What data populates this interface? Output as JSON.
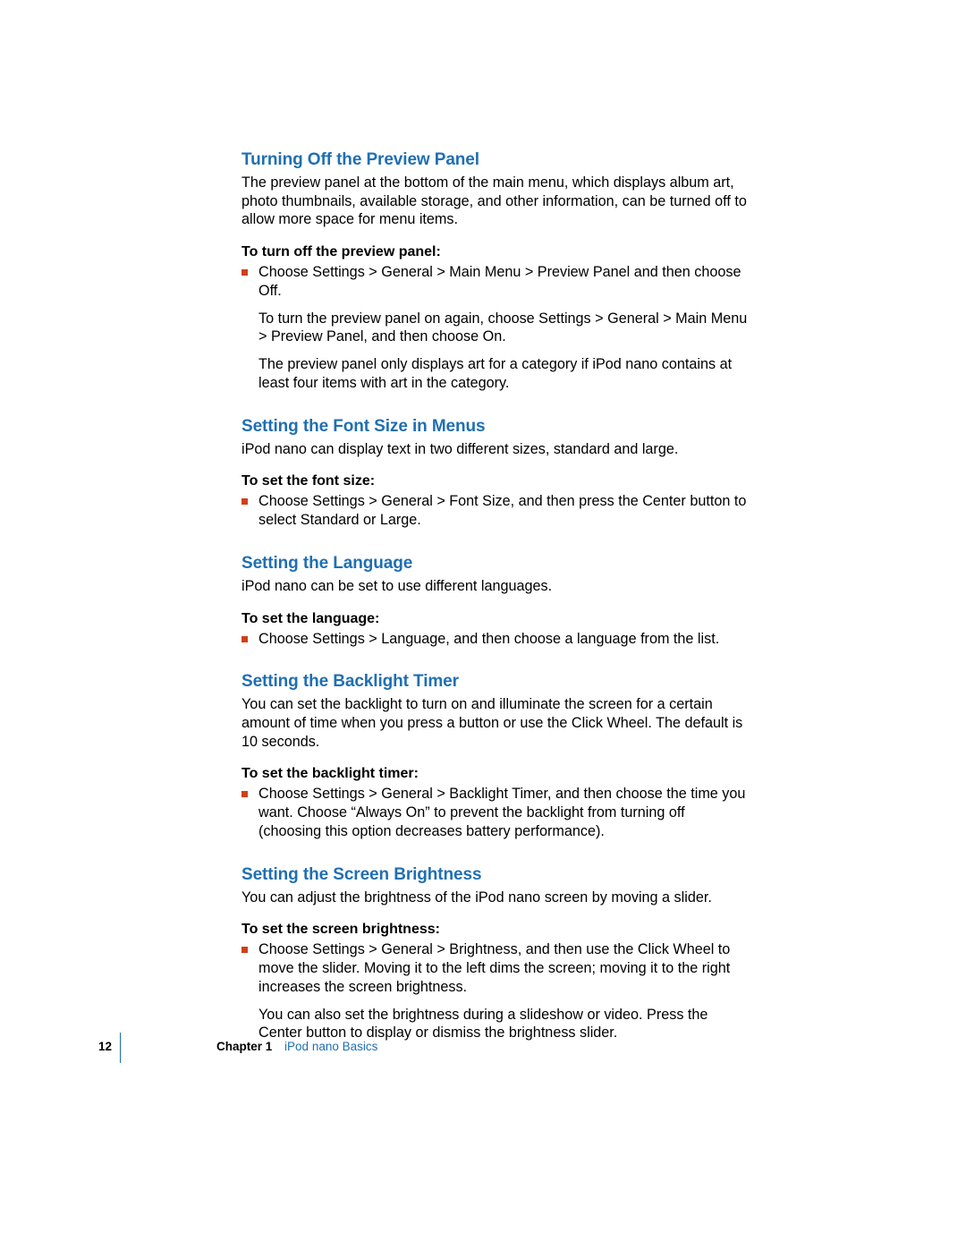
{
  "sections": [
    {
      "heading": "Turning Off the Preview Panel",
      "intro": "The preview panel at the bottom of the main menu, which displays album art, photo thumbnails, available storage, and other information, can be turned off to allow more space for menu items.",
      "lead": "To turn off the preview panel:",
      "step": "Choose Settings > General > Main Menu > Preview Panel and then choose Off.",
      "follow1": "To turn the preview panel on again, choose Settings > General > Main Menu > Preview Panel, and then choose On.",
      "follow2": "The preview panel only displays art for a category if iPod nano contains at least four items with art in the category."
    },
    {
      "heading": "Setting the Font Size in Menus",
      "intro": "iPod nano can display text in two different sizes, standard and large.",
      "lead": "To set the font size:",
      "step": "Choose Settings > General > Font Size, and then press the Center button to select Standard or Large."
    },
    {
      "heading": "Setting the Language",
      "intro": "iPod nano can be set to use different languages.",
      "lead": "To set the language:",
      "step": "Choose Settings > Language, and then choose a language from the list."
    },
    {
      "heading": "Setting the Backlight Timer",
      "intro": "You can set the backlight to turn on and illuminate the screen for a certain amount of time when you press a button or use the Click Wheel. The default is 10 seconds.",
      "lead": "To set the backlight timer:",
      "step": "Choose Settings > General > Backlight Timer, and then choose the time you want. Choose “Always On” to prevent the backlight from turning off (choosing this option decreases battery performance)."
    },
    {
      "heading": "Setting the Screen Brightness",
      "intro": "You can adjust the brightness of the iPod nano screen by moving a slider.",
      "lead": "To set the screen brightness:",
      "step": "Choose Settings > General > Brightness, and then use the Click Wheel to move the slider. Moving it to the left dims the screen; moving it to the right increases the screen brightness.",
      "follow1": "You can also set the brightness during a slideshow or video. Press the Center button to display or dismiss the brightness slider."
    }
  ],
  "footer": {
    "page": "12",
    "chapter_label": "Chapter 1",
    "chapter_title": "iPod nano Basics"
  }
}
